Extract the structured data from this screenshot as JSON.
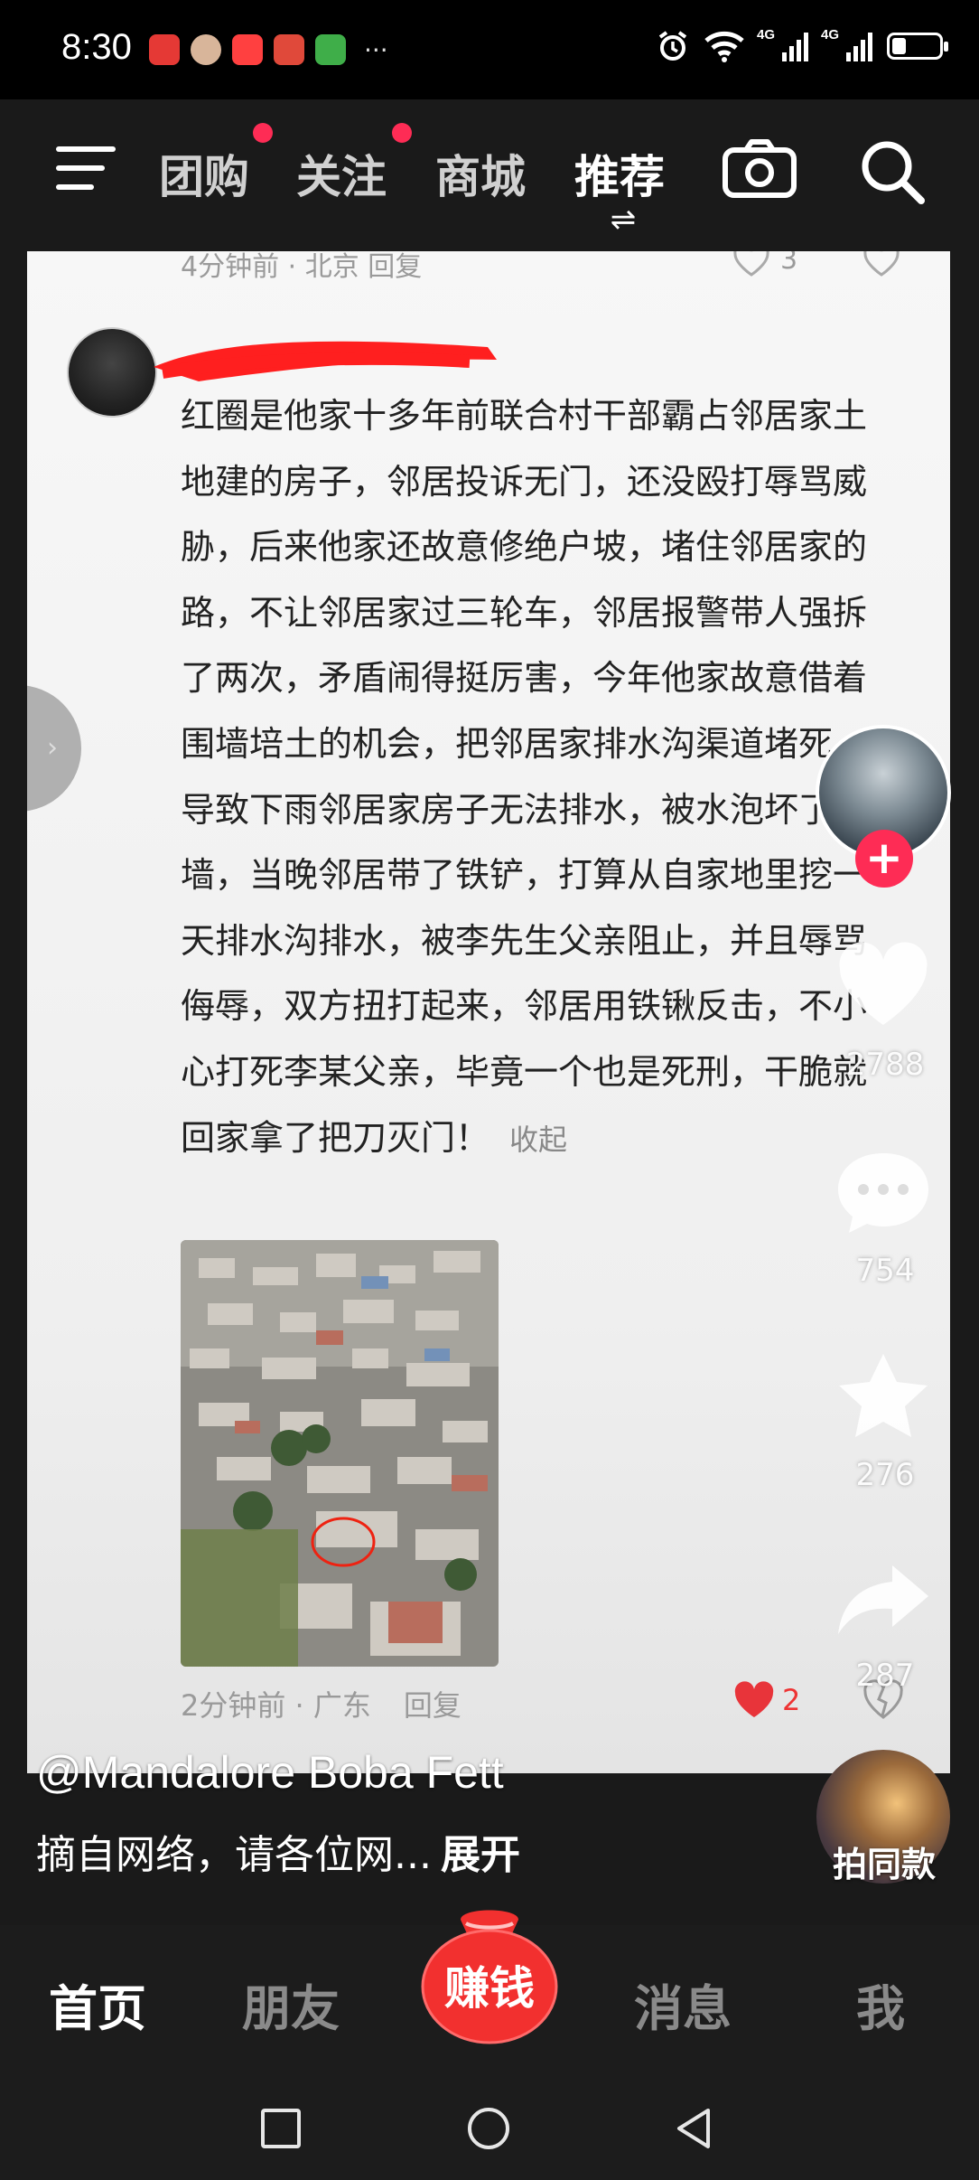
{
  "status_bar": {
    "time": "8:30",
    "more": "···",
    "network_1": "4G",
    "network_2": "4G",
    "battery_level": 0.3
  },
  "top_nav": {
    "tabs": [
      {
        "label": "团购",
        "has_dot": true
      },
      {
        "label": "关注",
        "has_dot": true
      },
      {
        "label": "商城",
        "has_dot": false
      },
      {
        "label": "推荐",
        "has_dot": false,
        "active": true
      }
    ]
  },
  "previous_comment": {
    "meta": "4分钟前 · 北京    回复",
    "likes": "3"
  },
  "comment": {
    "text": "红圈是他家十多年前联合村干部霸占邻居家土地建的房子，邻居投诉无门，还没殴打辱骂威胁，后来他家还故意修绝户坡，堵住邻居家的路，不让邻居家过三轮车，邻居报警带人强拆了两次，矛盾闹得挺厉害，今年他家故意借着围墙培土的机会，把邻居家排水沟渠道堵死，导致下雨邻居家房子无法排水，被水泡坏了围墙，当晚邻居带了铁铲，打算从自家地里挖一天排水沟排水，被李先生父亲阻止，并且辱骂侮辱，双方扭打起来，邻居用铁锹反击，不小心打死李某父亲，毕竟一个也是死刑，干脆就回家拿了把刀灭门！",
    "collapse_label": "收起",
    "time": "2分钟前 · 广东",
    "reply_label": "回复",
    "likes": "2"
  },
  "rail": {
    "likes": "2788",
    "comments": "754",
    "favorites": "276",
    "shares": "287"
  },
  "video": {
    "author": "@Mandalore Boba  Fett",
    "caption": "摘自网络，请各位网...",
    "expand_label": "展开",
    "music_label": "拍同款"
  },
  "bottom_nav": {
    "home": "首页",
    "friends": "朋友",
    "earn": "赚钱",
    "messages": "消息",
    "me": "我"
  },
  "colors": {
    "accent": "#fe2c55",
    "earn_red": "#f2302f"
  }
}
